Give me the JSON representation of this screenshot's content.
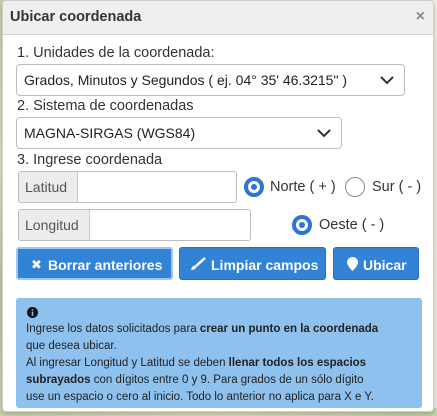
{
  "dialog": {
    "title": "Ubicar coordenada",
    "close": "×"
  },
  "step1": {
    "label": "1. Unidades de la coordenada:",
    "selected": "Grados, Minutos y Segundos ( ej. 04° 35' 46.3215\" )"
  },
  "step2": {
    "label": "2. Sistema de coordenadas",
    "selected": "MAGNA-SIRGAS (WGS84)"
  },
  "step3": {
    "label": "3. Ingrese coordenada",
    "latitud_label": "Latitud",
    "latitud_value": "",
    "longitud_label": "Longitud",
    "longitud_value": "",
    "norte_label": "Norte ( + )",
    "norte_selected": true,
    "sur_label": "Sur ( - )",
    "sur_selected": false,
    "oeste_label": "Oeste ( - )",
    "oeste_selected": true
  },
  "buttons": {
    "borrar": "Borrar anteriores",
    "limpiar": "Limpiar campos",
    "ubicar": "Ubicar"
  },
  "info": {
    "line1_pre": "Ingrese los datos solicitados para ",
    "line1_bold": "crear un punto en la coordenada",
    "line2": "que desea ubicar.",
    "line3_pre": "Al ingresar Longitud y Latitud se deben ",
    "line3_bold": "llenar todos los espacios",
    "line4_bold": "subrayados",
    "line4_post": " con dígitos entre 0 y 9. Para grados de un sólo dígito",
    "line5": "use un espacio o cero al inicio. Todo lo anterior no aplica para X e Y."
  },
  "colors": {
    "accent": "#3283d6",
    "info_bg": "#8ec1ee",
    "radio_on": "#2d74d9"
  }
}
